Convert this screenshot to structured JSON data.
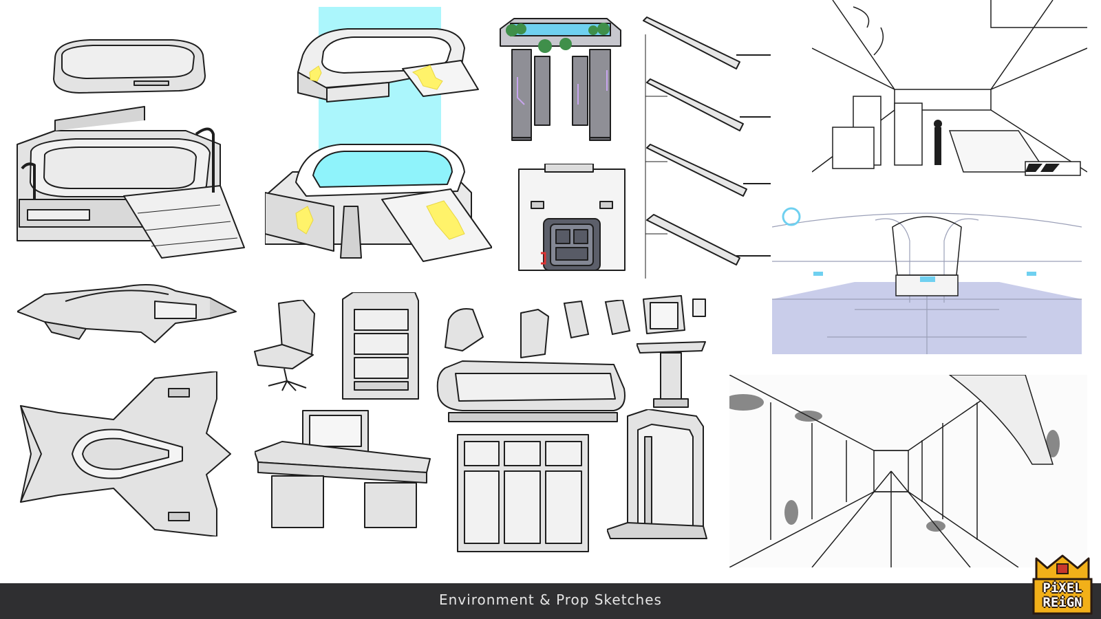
{
  "footer": {
    "title": "Environment & Prop Sketches"
  },
  "logo": {
    "line1": "PiXEL",
    "line2": "REiGN"
  },
  "colors": {
    "background": "#ffffff",
    "footer_bar": "#2f2f31",
    "footer_text": "#e6e6e6",
    "sketch_fill": "#e3e3e3",
    "sketch_line": "#1e1e1e",
    "holo_cyan": "#8ff3fb",
    "arrow_yellow": "#fff36a",
    "pillar_gray": "#8f8f96",
    "plant_green": "#3f8f4a",
    "floor_lavender": "#c9cdea",
    "logo_gold": "#f2b019",
    "logo_red": "#c8372d"
  }
}
